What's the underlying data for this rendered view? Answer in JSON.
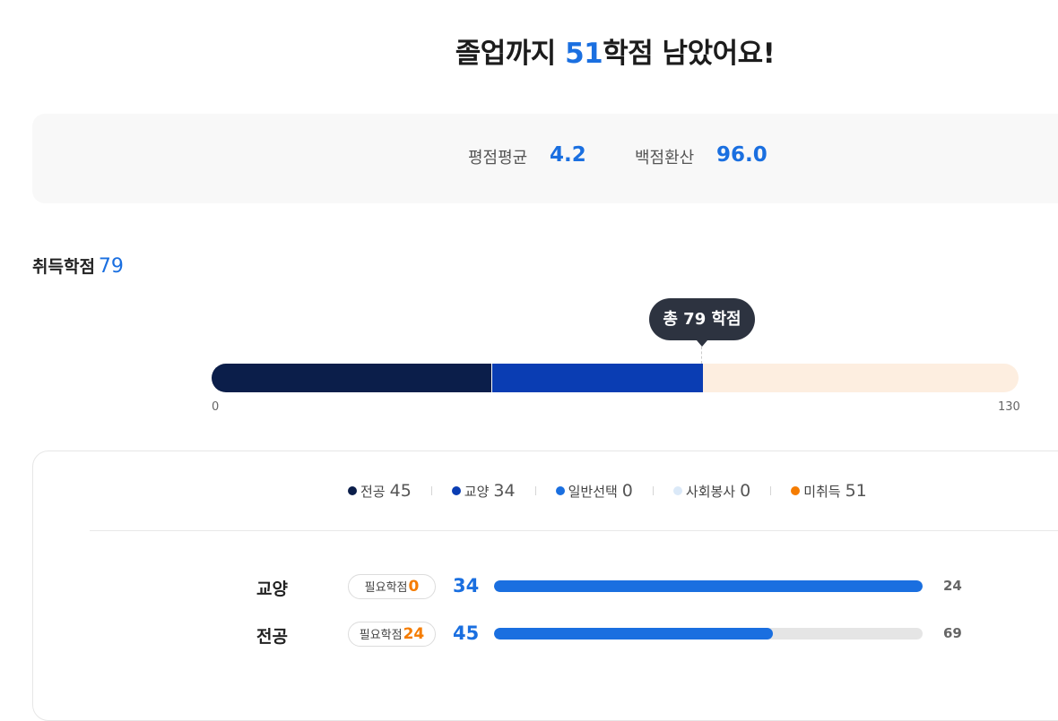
{
  "headline": {
    "prefix": "졸업까지 ",
    "remaining": "51",
    "suffix": "학점 남았어요!"
  },
  "gpa": {
    "avg_label": "평점평균",
    "avg_value": "4.2",
    "pct_label": "백점환산",
    "pct_value": "96.0"
  },
  "earned": {
    "label": "취득학점",
    "value": "79"
  },
  "progress": {
    "tooltip": "총 79 학점",
    "min_label": "0",
    "max_label": "130",
    "total": 130,
    "segments": [
      {
        "name": "전공",
        "value": 45,
        "color": "#0b1e4a"
      },
      {
        "name": "교양",
        "value": 34,
        "color": "#0a3db3"
      }
    ],
    "remaining_color": "#fdeee0"
  },
  "legend": [
    {
      "label": "전공",
      "value": "45",
      "color": "#0b1e4a"
    },
    {
      "label": "교양",
      "value": "34",
      "color": "#0a3db3"
    },
    {
      "label": "일반선택",
      "value": "0",
      "color": "#1a6fe0"
    },
    {
      "label": "사회봉사",
      "value": "0",
      "color": "#dbe9f8"
    },
    {
      "label": "미취득",
      "value": "51",
      "color": "#f57c00"
    }
  ],
  "rows": [
    {
      "name": "교양",
      "pill_label": "필요학점",
      "pill_value": "0",
      "current": "34",
      "remaining": "24",
      "progress": 1.0
    },
    {
      "name": "전공",
      "pill_label": "필요학점",
      "pill_value": "24",
      "current": "45",
      "remaining": "69",
      "progress": 0.65
    }
  ]
}
